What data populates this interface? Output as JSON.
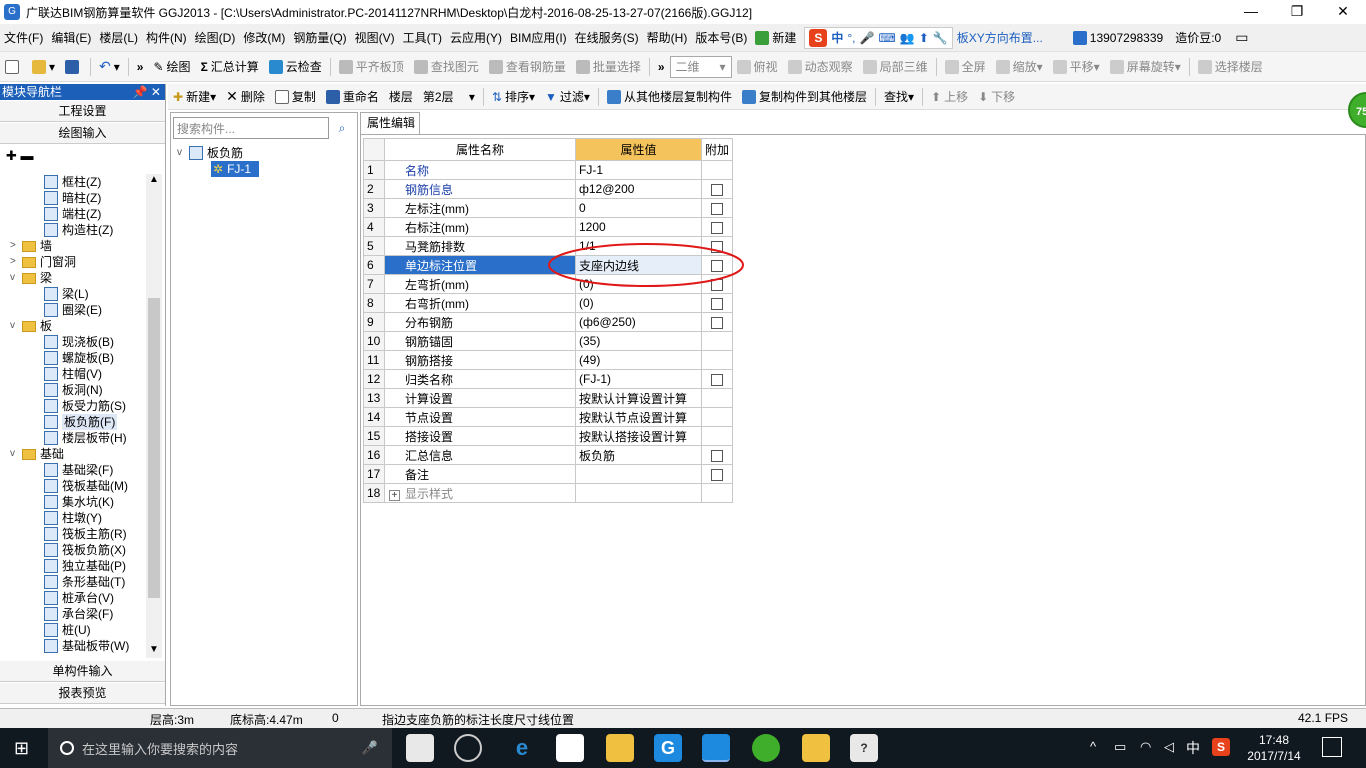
{
  "window": {
    "title": "广联达BIM钢筋算量软件 GGJ2013 - [C:\\Users\\Administrator.PC-20141127NRHM\\Desktop\\白龙村-2016-08-25-13-27-07(2166版).GGJ12]"
  },
  "menu": [
    "文件(F)",
    "编辑(E)",
    "楼层(L)",
    "构件(N)",
    "绘图(D)",
    "修改(M)",
    "钢筋量(Q)",
    "视图(V)",
    "工具(T)",
    "云应用(Y)",
    "BIM应用(I)",
    "在线服务(S)",
    "帮助(H)",
    "版本号(B)"
  ],
  "menu_right": {
    "new_label": "新建",
    "notice": "板XY方向布置...",
    "phone": "13907298339",
    "coins": "造价豆:0"
  },
  "toolbar1": {
    "draw": "绘图",
    "sum": "汇总计算",
    "cloud_check": "云检查",
    "align_top": "平齐板顶",
    "find_elem": "查找图元",
    "view_rebar": "查看钢筋量",
    "batch_select": "批量选择",
    "view_mode": "二维",
    "overlook": "俯视",
    "dynamic": "动态观察",
    "local3d": "局部三维",
    "fullscreen": "全屏",
    "zoom": "缩放",
    "pan": "平移",
    "rotate": "屏幕旋转",
    "select_floor": "选择楼层"
  },
  "toolbar2": {
    "new": "新建",
    "delete": "删除",
    "copy": "复制",
    "rename": "重命名",
    "floor_label": "楼层",
    "floor_value": "第2层",
    "sort": "排序",
    "filter": "过滤",
    "copy_from": "从其他楼层复制构件",
    "copy_to": "复制构件到其他楼层",
    "find": "查找",
    "move_up": "上移",
    "move_down": "下移"
  },
  "nav": {
    "header": "模块导航栏",
    "project_settings": "工程设置",
    "drawing_input": "绘图输入",
    "single_input": "单构件输入",
    "report_preview": "报表预览",
    "tree": [
      {
        "label": "框柱(Z)",
        "level": 2
      },
      {
        "label": "暗柱(Z)",
        "level": 2
      },
      {
        "label": "端柱(Z)",
        "level": 2
      },
      {
        "label": "构造柱(Z)",
        "level": 2
      },
      {
        "label": "墙",
        "level": 1,
        "exp": ">"
      },
      {
        "label": "门窗洞",
        "level": 1,
        "exp": ">"
      },
      {
        "label": "梁",
        "level": 1,
        "exp": "v"
      },
      {
        "label": "梁(L)",
        "level": 2
      },
      {
        "label": "圈梁(E)",
        "level": 2
      },
      {
        "label": "板",
        "level": 1,
        "exp": "v"
      },
      {
        "label": "现浇板(B)",
        "level": 2
      },
      {
        "label": "螺旋板(B)",
        "level": 2
      },
      {
        "label": "柱帽(V)",
        "level": 2
      },
      {
        "label": "板洞(N)",
        "level": 2
      },
      {
        "label": "板受力筋(S)",
        "level": 2
      },
      {
        "label": "板负筋(F)",
        "level": 2,
        "selected": true
      },
      {
        "label": "楼层板带(H)",
        "level": 2
      },
      {
        "label": "基础",
        "level": 1,
        "exp": "v"
      },
      {
        "label": "基础梁(F)",
        "level": 2
      },
      {
        "label": "筏板基础(M)",
        "level": 2
      },
      {
        "label": "集水坑(K)",
        "level": 2
      },
      {
        "label": "柱墩(Y)",
        "level": 2
      },
      {
        "label": "筏板主筋(R)",
        "level": 2
      },
      {
        "label": "筏板负筋(X)",
        "level": 2
      },
      {
        "label": "独立基础(P)",
        "level": 2
      },
      {
        "label": "条形基础(T)",
        "level": 2
      },
      {
        "label": "桩承台(V)",
        "level": 2
      },
      {
        "label": "承台梁(F)",
        "level": 2
      },
      {
        "label": "桩(U)",
        "level": 2
      },
      {
        "label": "基础板带(W)",
        "level": 2
      }
    ]
  },
  "components": {
    "search_placeholder": "搜索构件...",
    "root": "板负筋",
    "child": "FJ-1"
  },
  "props": {
    "tab": "属性编辑",
    "col_name": "属性名称",
    "col_value": "属性值",
    "col_extra": "附加",
    "rows": [
      {
        "n": "1",
        "name": "名称",
        "value": "FJ-1",
        "chk": false,
        "blue": true
      },
      {
        "n": "2",
        "name": "钢筋信息",
        "value": "ф12@200",
        "chk": true,
        "blue": true
      },
      {
        "n": "3",
        "name": "左标注(mm)",
        "value": "0",
        "chk": true
      },
      {
        "n": "4",
        "name": "右标注(mm)",
        "value": "1200",
        "chk": true
      },
      {
        "n": "5",
        "name": "马凳筋排数",
        "value": "1/1",
        "chk": true
      },
      {
        "n": "6",
        "name": "单边标注位置",
        "value": "支座内边线",
        "chk": true,
        "selected": true
      },
      {
        "n": "7",
        "name": "左弯折(mm)",
        "value": "(0)",
        "chk": true
      },
      {
        "n": "8",
        "name": "右弯折(mm)",
        "value": "(0)",
        "chk": true
      },
      {
        "n": "9",
        "name": "分布钢筋",
        "value": "(ф6@250)",
        "chk": true
      },
      {
        "n": "10",
        "name": "钢筋锚固",
        "value": "(35)",
        "chk": false
      },
      {
        "n": "11",
        "name": "钢筋搭接",
        "value": "(49)",
        "chk": false
      },
      {
        "n": "12",
        "name": "归类名称",
        "value": "(FJ-1)",
        "chk": true
      },
      {
        "n": "13",
        "name": "计算设置",
        "value": "按默认计算设置计算",
        "chk": false
      },
      {
        "n": "14",
        "name": "节点设置",
        "value": "按默认节点设置计算",
        "chk": false
      },
      {
        "n": "15",
        "name": "搭接设置",
        "value": "按默认搭接设置计算",
        "chk": false
      },
      {
        "n": "16",
        "name": "汇总信息",
        "value": "板负筋",
        "chk": true
      },
      {
        "n": "17",
        "name": "备注",
        "value": "",
        "chk": true
      },
      {
        "n": "18",
        "name": "显示样式",
        "value": "",
        "chk": false,
        "plus": true
      }
    ]
  },
  "status": {
    "floor_height": "层高:3m",
    "base_height": "底标高:4.47m",
    "zero": "0",
    "hint": "指边支座负筋的标注长度尺寸线位置",
    "fps": "42.1 FPS"
  },
  "taskbar": {
    "search_placeholder": "在这里输入你要搜索的内容",
    "ime": "中",
    "time": "17:48",
    "date": "2017/7/14"
  },
  "badge": "75"
}
